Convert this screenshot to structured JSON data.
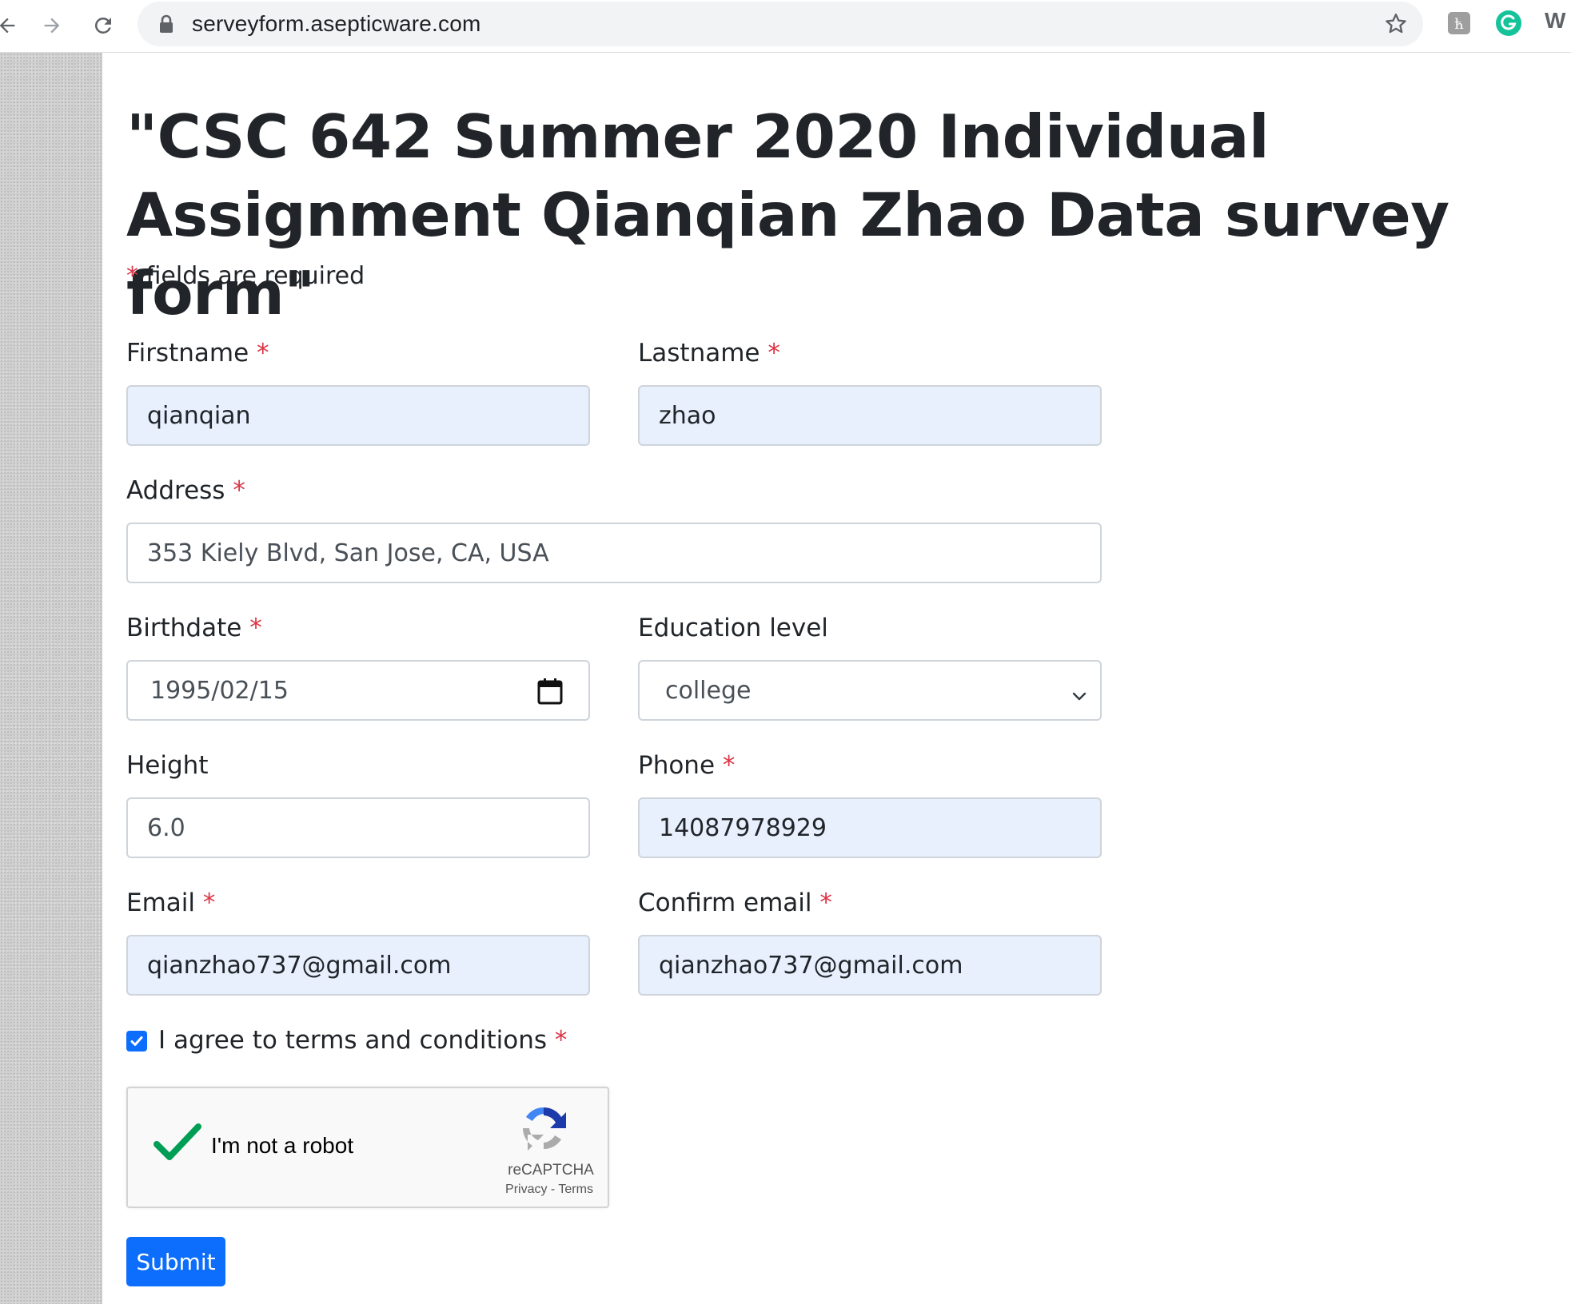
{
  "browser": {
    "url": "serveyform.asepticware.com",
    "extension_w": "W"
  },
  "page": {
    "title": "\"CSC 642 Summer 2020 Individual Assignment Qianqian Zhao Data survey form\"",
    "required_marker": "*",
    "required_note": " fields are required"
  },
  "form": {
    "firstname": {
      "label": "Firstname",
      "value": "qianqian"
    },
    "lastname": {
      "label": "Lastname",
      "value": "zhao"
    },
    "address": {
      "label": "Address",
      "value": "353 Kiely Blvd, San Jose, CA, USA"
    },
    "birthdate": {
      "label": "Birthdate",
      "value": "1995/02/15"
    },
    "education": {
      "label": "Education level",
      "value": "college"
    },
    "height": {
      "label": "Height",
      "value": "6.0"
    },
    "phone": {
      "label": "Phone",
      "value": "14087978929"
    },
    "email": {
      "label": "Email",
      "value": "qianzhao737@gmail.com"
    },
    "confirm_email": {
      "label": "Confirm email",
      "value": "qianzhao737@gmail.com"
    },
    "terms": {
      "label": "I agree to terms and conditions",
      "checked": true
    }
  },
  "recaptcha": {
    "label": "I'm not a robot",
    "brand": "reCAPTCHA",
    "privacy": "Privacy",
    "separator": " - ",
    "terms": "Terms"
  },
  "submit_label": "Submit",
  "colors": {
    "required": "#dc3545",
    "autofill_bg": "#e8f0fe",
    "primary": "#0d6efd",
    "recaptcha_check": "#009e55"
  }
}
